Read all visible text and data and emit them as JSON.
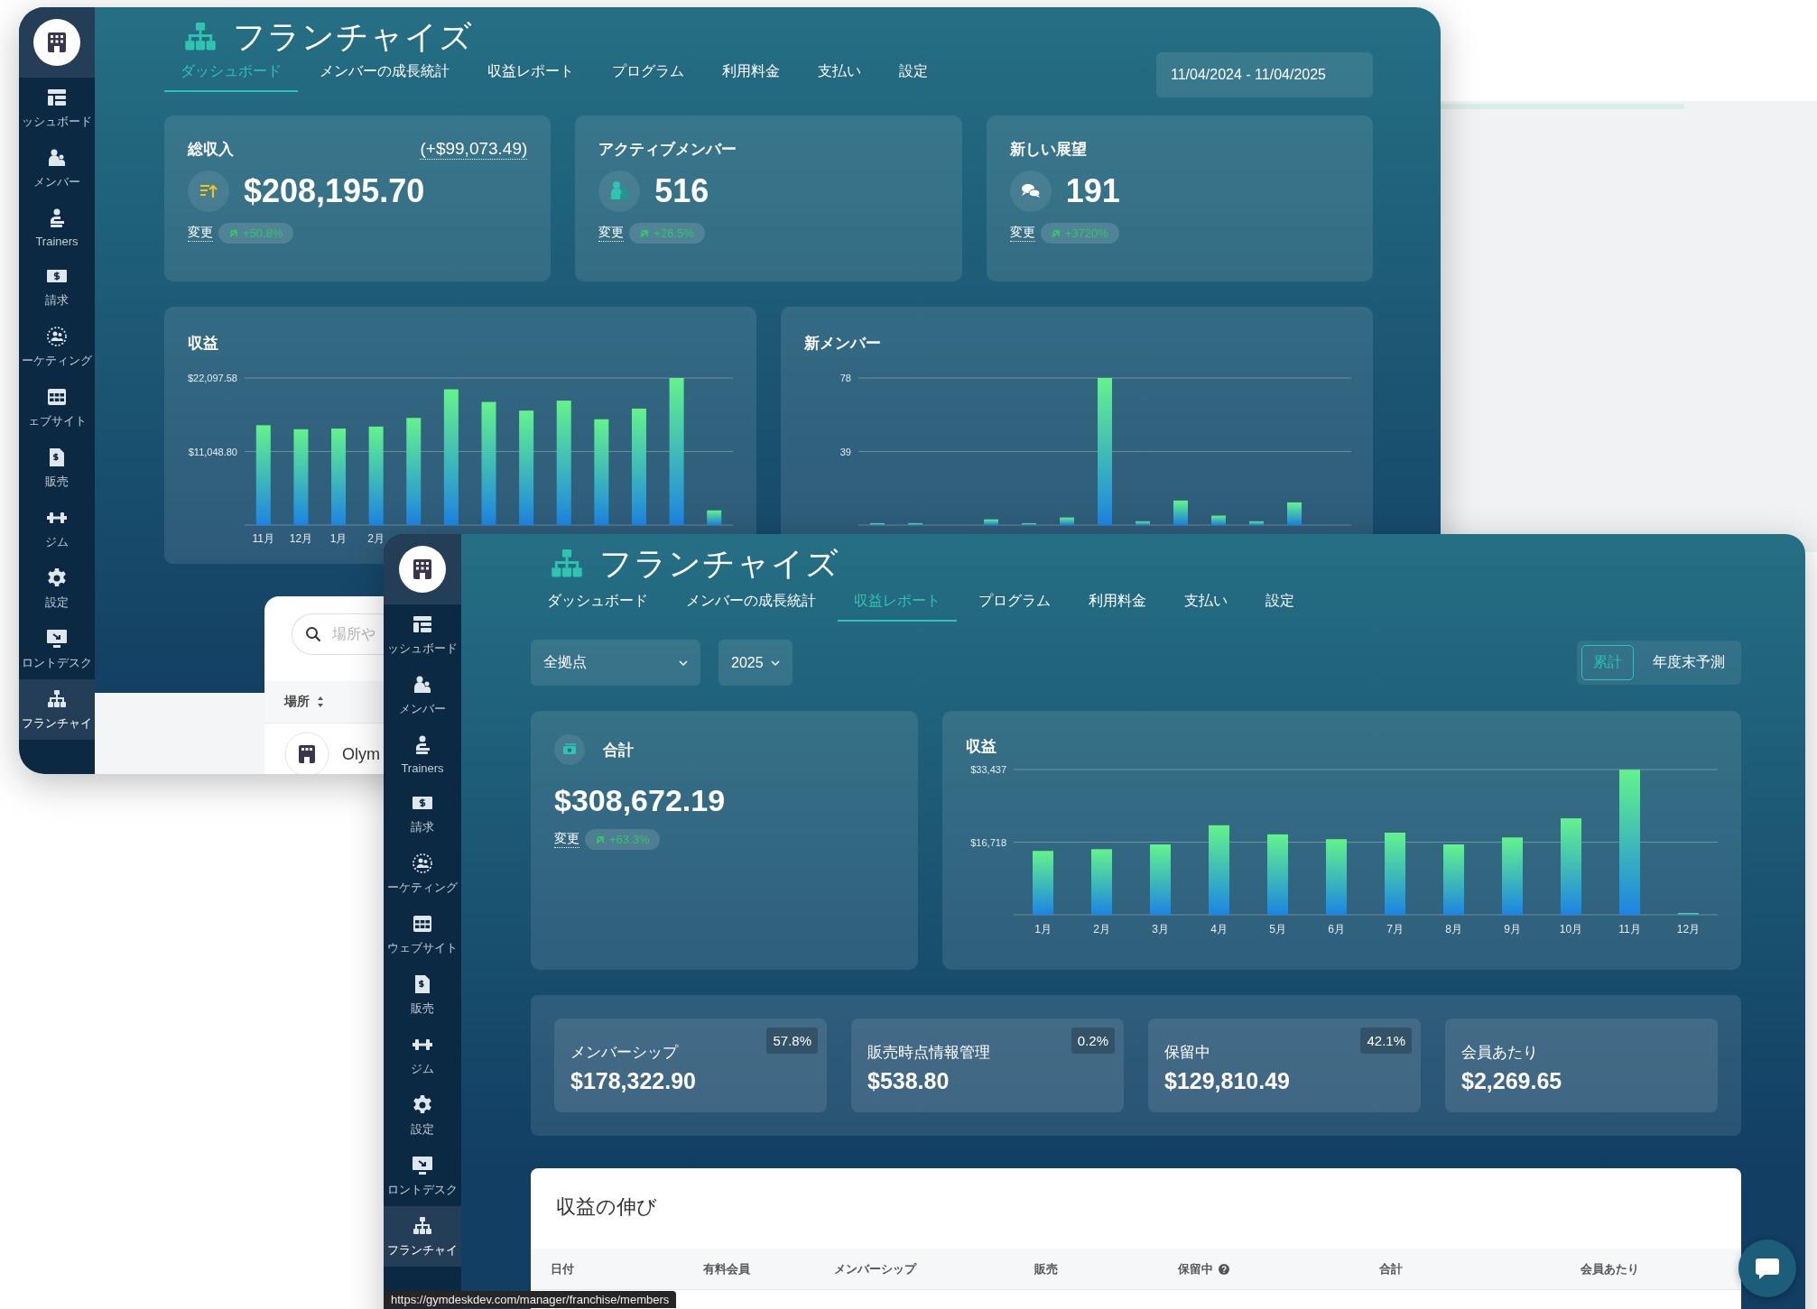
{
  "back_window": {
    "sidebar": {
      "items": [
        {
          "label": "ッシュボード",
          "selected": false
        },
        {
          "label": "メンバー",
          "selected": false
        },
        {
          "label": "Trainers",
          "selected": false
        },
        {
          "label": "請求",
          "selected": false
        },
        {
          "label": "ーケティング",
          "selected": false
        },
        {
          "label": "ェブサイト",
          "selected": false
        },
        {
          "label": "販売",
          "selected": false
        },
        {
          "label": "ジム",
          "selected": false
        },
        {
          "label": "設定",
          "selected": false
        },
        {
          "label": "ロントデスク",
          "selected": false
        },
        {
          "label": "フランチャイ",
          "selected": true
        }
      ]
    },
    "title": "フランチャイズ",
    "tabs": [
      {
        "label": "ダッシュボード",
        "selected": true
      },
      {
        "label": "メンバーの成長統計",
        "selected": false
      },
      {
        "label": "収益レポート",
        "selected": false
      },
      {
        "label": "プログラム",
        "selected": false
      },
      {
        "label": "利用料金",
        "selected": false
      },
      {
        "label": "支払い",
        "selected": false
      },
      {
        "label": "設定",
        "selected": false
      }
    ],
    "date_range": "11/04/2024 - 11/04/2025",
    "stats": [
      {
        "title": "総収入",
        "delta": "(+$99,073.49)",
        "value": "$208,195.70",
        "change_label": "変更",
        "change": "+50.8%"
      },
      {
        "title": "アクティブメンバー",
        "value": "516",
        "change_label": "変更",
        "change": "+26.5%"
      },
      {
        "title": "新しい展望",
        "value": "191",
        "change_label": "変更",
        "change": "+3720%"
      }
    ],
    "charts": [
      {
        "chart_data": {
          "type": "bar",
          "title": "収益",
          "ylim": [
            0,
            22100
          ],
          "yticks": [
            {
              "value": 22097.58,
              "label": "$22,097.58"
            },
            {
              "value": 11048.8,
              "label": "$11,048.80"
            }
          ],
          "categories": [
            "11月",
            "12月",
            "1月",
            "2月",
            null,
            null,
            null,
            null,
            null,
            null,
            null,
            null,
            null
          ],
          "values": [
            15000,
            14400,
            14500,
            14800,
            16100,
            20400,
            18500,
            17200,
            18700,
            15900,
            17500,
            22100,
            2200
          ]
        }
      },
      {
        "chart_data": {
          "type": "bar",
          "title": "新メンバー",
          "ylim": [
            0,
            78
          ],
          "yticks": [
            {
              "value": 78,
              "label": "78"
            },
            {
              "value": 39,
              "label": "39"
            }
          ],
          "values": [
            1,
            1,
            0,
            3,
            1,
            4,
            78,
            2,
            13,
            5,
            2,
            12,
            0
          ]
        }
      }
    ],
    "locations": {
      "search_placeholder": "場所や",
      "column": "場所",
      "rows": [
        {
          "name": "Olym"
        }
      ]
    }
  },
  "front_window": {
    "sidebar": {
      "items": [
        {
          "label": "ッシュボード",
          "selected": false
        },
        {
          "label": "メンバー",
          "selected": false
        },
        {
          "label": "Trainers",
          "selected": false
        },
        {
          "label": "請求",
          "selected": false
        },
        {
          "label": "ーケティング",
          "selected": false
        },
        {
          "label": "ウェブサイト",
          "selected": false
        },
        {
          "label": "販売",
          "selected": false
        },
        {
          "label": "ジム",
          "selected": false
        },
        {
          "label": "設定",
          "selected": false
        },
        {
          "label": "ロントデスク",
          "selected": false
        },
        {
          "label": "フランチャイ",
          "selected": true
        }
      ]
    },
    "title": "フランチャイズ",
    "tabs": [
      {
        "label": "ダッシュボード",
        "selected": false
      },
      {
        "label": "メンバーの成長統計",
        "selected": false
      },
      {
        "label": "収益レポート",
        "selected": true
      },
      {
        "label": "プログラム",
        "selected": false
      },
      {
        "label": "利用料金",
        "selected": false
      },
      {
        "label": "支払い",
        "selected": false
      },
      {
        "label": "設定",
        "selected": false
      }
    ],
    "location_filter": "全拠点",
    "year_filter": "2025",
    "view_toggle": [
      {
        "label": "累計",
        "selected": true
      },
      {
        "label": "年度末予測",
        "selected": false
      }
    ],
    "total": {
      "title": "合計",
      "value": "$308,672.19",
      "change_label": "変更",
      "change": "+63.3%"
    },
    "chart": {
      "chart_data": {
        "type": "bar",
        "title": "収益",
        "ylim": [
          0,
          33437
        ],
        "yticks": [
          {
            "value": 33437,
            "label": "$33,437"
          },
          {
            "value": 16718,
            "label": "$16,718"
          }
        ],
        "categories": [
          "1月",
          "2月",
          "3月",
          "4月",
          "5月",
          "6月",
          "7月",
          "8月",
          "9月",
          "10月",
          "11月",
          "12月"
        ],
        "values": [
          14700,
          15100,
          16200,
          20600,
          18500,
          17400,
          18900,
          16200,
          17800,
          22200,
          33400,
          400
        ]
      }
    },
    "breakdown": [
      {
        "label": "メンバーシップ",
        "share": "57.8%",
        "value": "$178,322.90"
      },
      {
        "label": "販売時点情報管理",
        "share": "0.2%",
        "value": "$538.80"
      },
      {
        "label": "保留中",
        "share": "42.1%",
        "value": "$129,810.49"
      },
      {
        "label": "会員あたり",
        "value": "$2,269.65"
      }
    ],
    "growth_table": {
      "title": "収益の伸び",
      "columns": [
        {
          "label": "日付",
          "help": false
        },
        {
          "label": "有料会員",
          "help": false
        },
        {
          "label": "メンバーシップ",
          "help": false
        },
        {
          "label": "販売",
          "help": false
        },
        {
          "label": "保留中",
          "help": true
        },
        {
          "label": "合計",
          "help": false
        },
        {
          "label": "会員あたり",
          "help": false
        }
      ]
    }
  },
  "status_url": "https://gymdeskdev.com/manager/franchise/members"
}
